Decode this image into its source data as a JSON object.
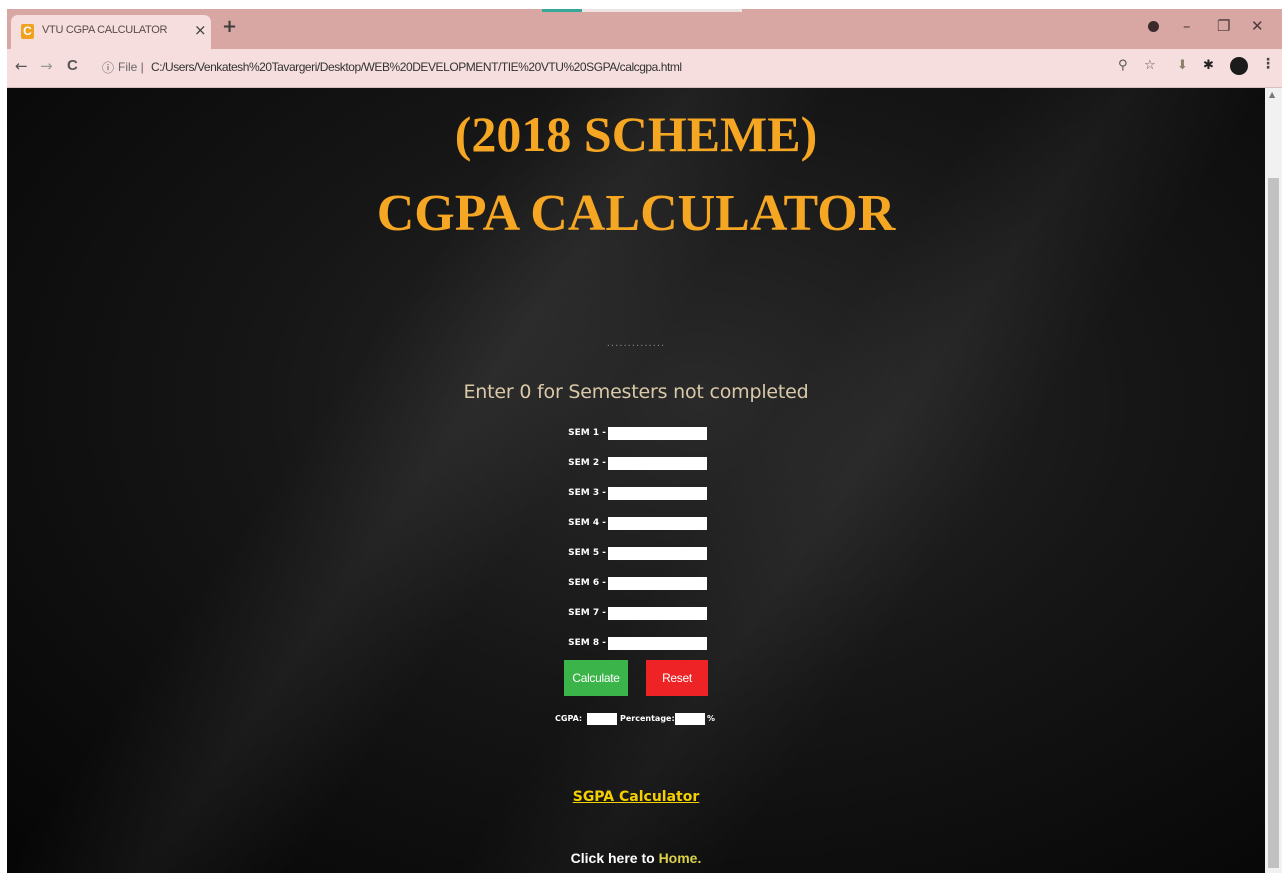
{
  "browser": {
    "tab_title": "VTU CGPA CALCULATOR",
    "favicon_letter": "C",
    "tab_close": "×",
    "new_tab": "+",
    "controls": {
      "minimize": "–",
      "maximize": "❐",
      "close": "✕"
    },
    "nav": {
      "back": "←",
      "forward": "→",
      "reload": "C"
    },
    "address": {
      "info_icon": "ⓘ",
      "scheme_label": "File |",
      "url": "C:/Users/Venkatesh%20Tavargeri/Desktop/WEB%20DEVELOPMENT/TIE%20VTU%20SGPA/calcgpa.html"
    },
    "toolbar_icons": {
      "zoom": "⚲",
      "star": "☆",
      "extension": "⬇",
      "puzzle": "✱",
      "menu": "⋮"
    }
  },
  "page": {
    "scheme_title": "(2018 SCHEME)",
    "main_title": "CGPA CALCULATOR",
    "dots": "..............",
    "instruction": "Enter 0 for Semesters not completed",
    "semesters": [
      {
        "label": "SEM 1 -",
        "value": ""
      },
      {
        "label": "SEM 2 -",
        "value": ""
      },
      {
        "label": "SEM 3 -",
        "value": ""
      },
      {
        "label": "SEM 4 -",
        "value": ""
      },
      {
        "label": "SEM 5 -",
        "value": ""
      },
      {
        "label": "SEM 6 -",
        "value": ""
      },
      {
        "label": "SEM 7 -",
        "value": ""
      },
      {
        "label": "SEM 8 -",
        "value": ""
      }
    ],
    "buttons": {
      "calculate": "Calculate",
      "reset": "Reset"
    },
    "result": {
      "cgpa_label": "CGPA:",
      "percentage_label": "Percentage:",
      "percent_sign": "%"
    },
    "sgpa_link": "SGPA Calculator",
    "home_prefix": "Click here to ",
    "home_link": "Home."
  },
  "colors": {
    "title": "#f5a623",
    "calculate": "#3bb54a",
    "reset": "#ee2326",
    "link": "#f5d000"
  }
}
